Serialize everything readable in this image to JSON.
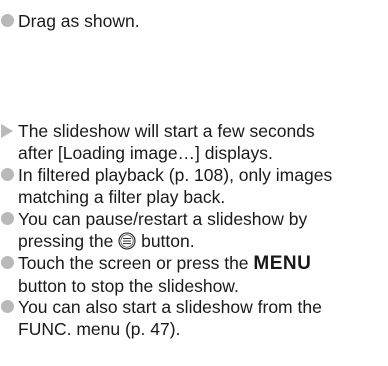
{
  "steps": [
    {
      "marker": "bullet-dot",
      "lines": [
        "Drag as shown."
      ]
    },
    {
      "marker": "result-arrow",
      "lines": [
        "The slideshow will start a few seconds",
        "after [Loading image…] displays."
      ]
    },
    {
      "marker": "bullet-dot",
      "lines": [
        "In filtered playback (p. 108), only images",
        "matching a filter play back."
      ]
    },
    {
      "marker": "bullet-dot",
      "line1": "You can pause/restart a slideshow by",
      "line2_before": "pressing the",
      "button_icon": "func-set-button-icon",
      "line2_after": "button."
    },
    {
      "marker": "bullet-dot",
      "line1_before": "Touch the screen or press the",
      "menu_word": "MENU",
      "line2": "button to stop the slideshow."
    },
    {
      "marker": "bullet-dot",
      "lines": [
        "You can also start a slideshow from the",
        "FUNC. menu (p. 47)."
      ]
    }
  ],
  "colors": {
    "marker": "#b9b9b9",
    "text": "#1a1a1a"
  }
}
